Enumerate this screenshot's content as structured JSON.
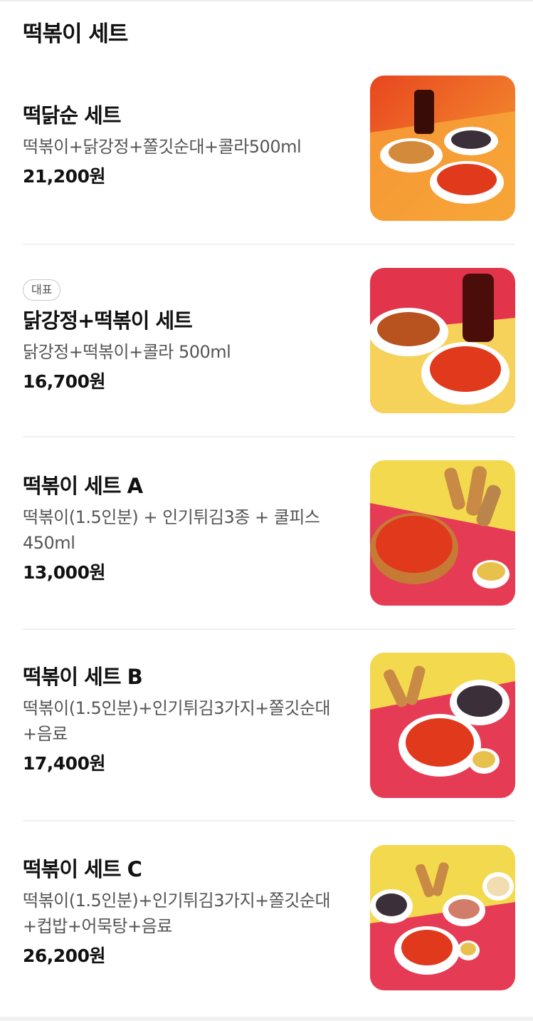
{
  "section": {
    "title": "떡볶이 세트"
  },
  "items": [
    {
      "badge": "",
      "name": "떡닭순 세트",
      "description": "떡볶이+닭강정+쫄깃순대+콜라500ml",
      "price": "21,200원",
      "image_icon": "food-photo-tteok-chicken-sundae-set"
    },
    {
      "badge": "대표",
      "name": "닭강정+떡볶이 세트",
      "description": "닭강정+떡볶이+콜라 500ml",
      "price": "16,700원",
      "image_icon": "food-photo-chicken-tteokbokki-set"
    },
    {
      "badge": "",
      "name": "떡볶이 세트 A",
      "description": "떡볶이(1.5인분) + 인기튀김3종 + 쿨피스 450ml",
      "price": "13,000원",
      "image_icon": "food-photo-set-a"
    },
    {
      "badge": "",
      "name": "떡볶이 세트 B",
      "description": "떡볶이(1.5인분)+인기튀김3가지+쫄깃순대+음료",
      "price": "17,400원",
      "image_icon": "food-photo-set-b"
    },
    {
      "badge": "",
      "name": "떡볶이 세트 C",
      "description": "떡볶이(1.5인분)+인기튀김3가지+쫄깃순대+컵밥+어묵탕+음료",
      "price": "26,200원",
      "image_icon": "food-photo-set-c"
    }
  ],
  "colors": {
    "text": "#111111",
    "subtext": "#555555",
    "divider": "#f0f0f0",
    "sauce": "#e0391c"
  }
}
